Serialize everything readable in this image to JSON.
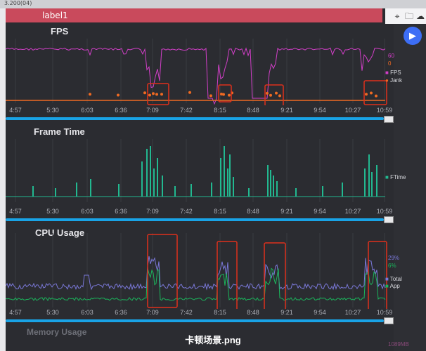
{
  "window": {
    "top_text": "3.200(04)",
    "label": "label1"
  },
  "toolbar": {
    "icons": [
      "location-icon",
      "folder-icon",
      "cloud-icon"
    ]
  },
  "caption": "卡顿场景.png",
  "x_ticks": [
    "4:57",
    "5:30",
    "6:03",
    "6:36",
    "7:09",
    "7:42",
    "8:15",
    "8:48",
    "9:21",
    "9:54",
    "10:27",
    "10:59"
  ],
  "fps": {
    "title": "FPS",
    "value_fps": "60",
    "value_jank": "0",
    "legend": [
      "FPS",
      "Jank"
    ]
  },
  "frametime": {
    "title": "Frame Time",
    "legend": [
      "FTime"
    ]
  },
  "cpu": {
    "title": "CPU Usage",
    "value_total": "29%",
    "value_app": "6%",
    "legend": [
      "Total",
      "App"
    ]
  },
  "memory": {
    "title": "Memory Usage",
    "value": "1089MB"
  },
  "colors": {
    "fps": "#d23fc8",
    "jank": "#ef6a22",
    "ftime": "#22b890",
    "total": "#7a78d8",
    "app": "#1bb55c",
    "highlight": "#e0301c",
    "scroll": "#19a3e6"
  },
  "chart_data": [
    {
      "type": "line",
      "title": "FPS",
      "series": [
        {
          "name": "FPS"
        },
        {
          "name": "Jank"
        }
      ]
    },
    {
      "type": "bar",
      "title": "Frame Time",
      "series": [
        {
          "name": "FTime"
        }
      ]
    },
    {
      "type": "line",
      "title": "CPU Usage",
      "series": [
        {
          "name": "Total"
        },
        {
          "name": "App"
        }
      ]
    }
  ]
}
